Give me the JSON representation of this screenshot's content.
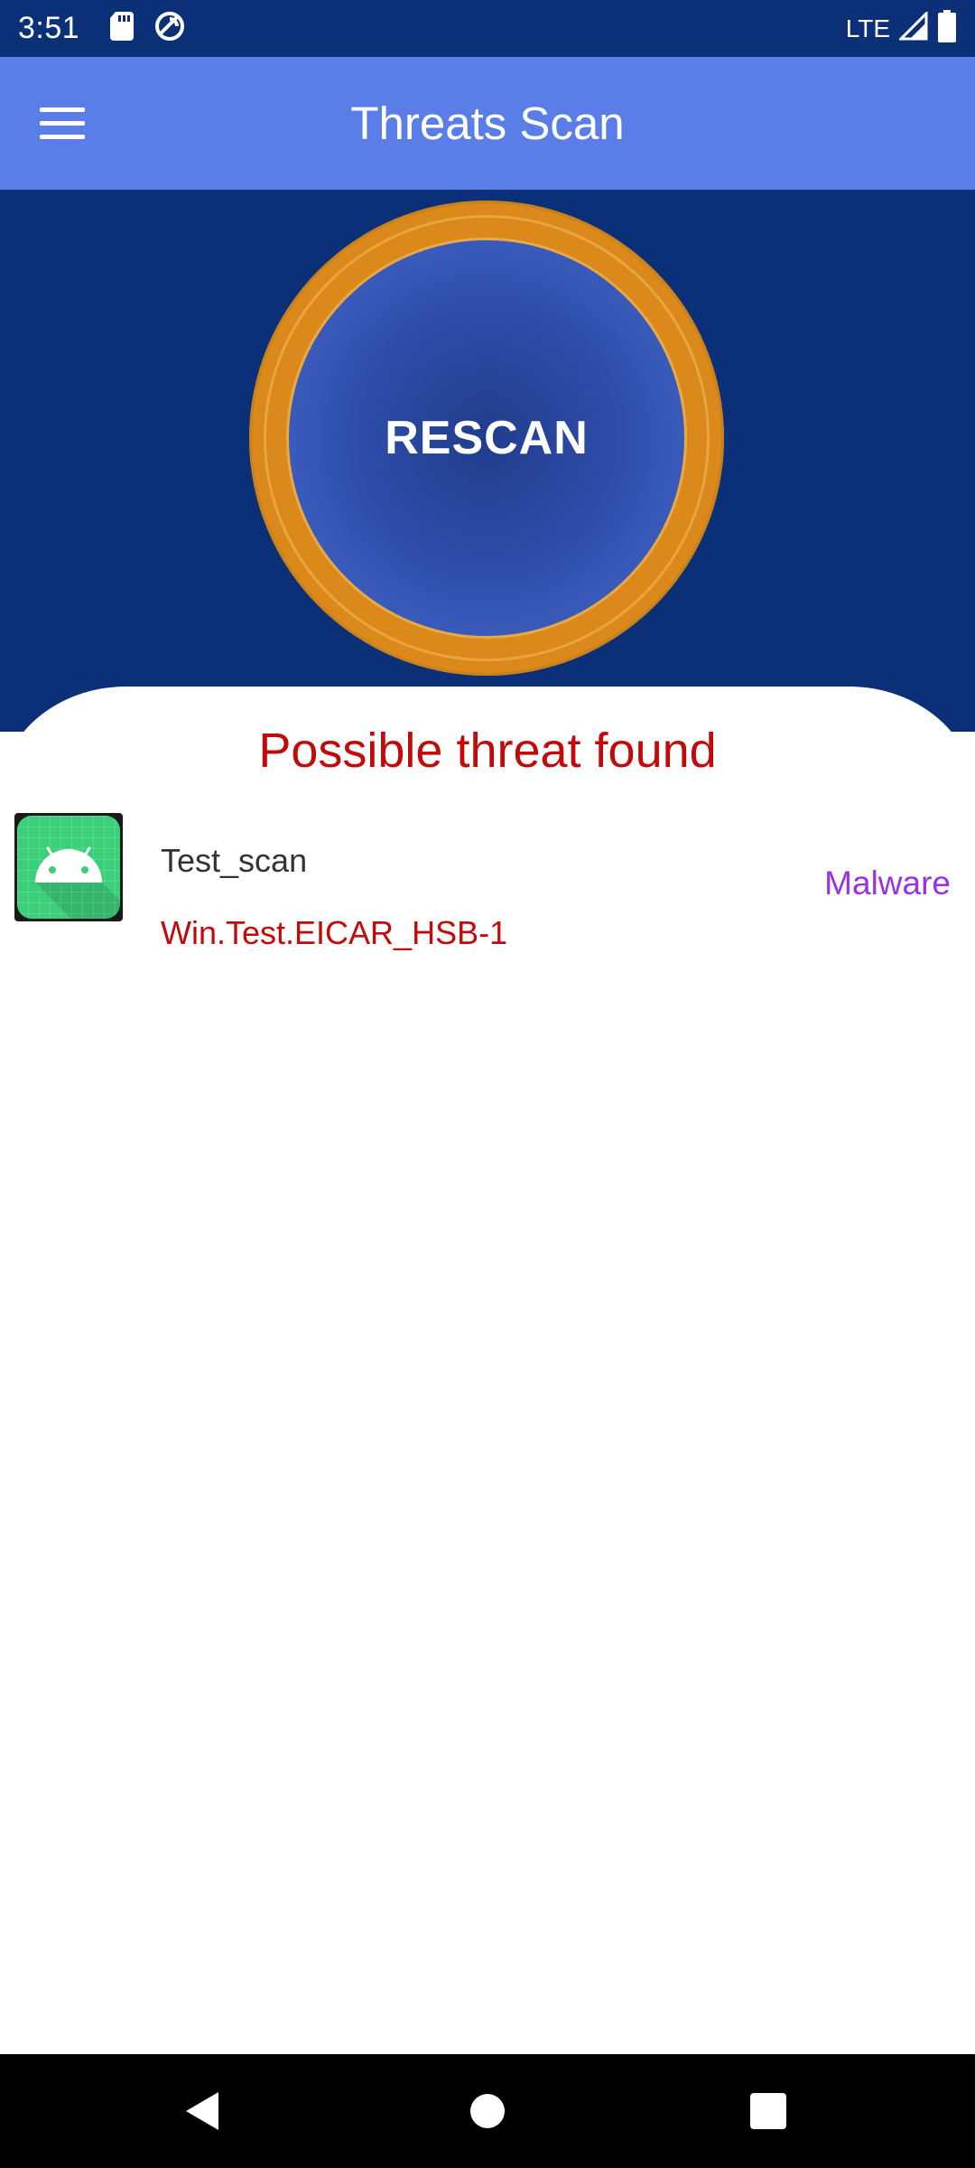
{
  "status_bar": {
    "time": "3:51",
    "network": "LTE",
    "icons": [
      "sd-card-icon",
      "data-saver-icon",
      "signal-icon",
      "battery-icon"
    ]
  },
  "app_bar": {
    "title": "Threats Scan",
    "menu_icon": "hamburger-menu-icon"
  },
  "scan": {
    "button_label": "RESCAN"
  },
  "results": {
    "heading": "Possible threat found",
    "items": [
      {
        "app_name": "Test_scan",
        "threat_name": "Win.Test.EICAR_HSB-1",
        "threat_type": "Malware",
        "icon": "android-app-icon"
      }
    ]
  },
  "nav_bar": {
    "buttons": [
      "back-icon",
      "home-icon",
      "recents-icon"
    ]
  },
  "colors": {
    "primary_dark": "#0b3078",
    "app_bar": "#5a7de8",
    "ring": "#d8891c",
    "threat_red": "#c20a0a",
    "malware_purple": "#9b31e6"
  }
}
